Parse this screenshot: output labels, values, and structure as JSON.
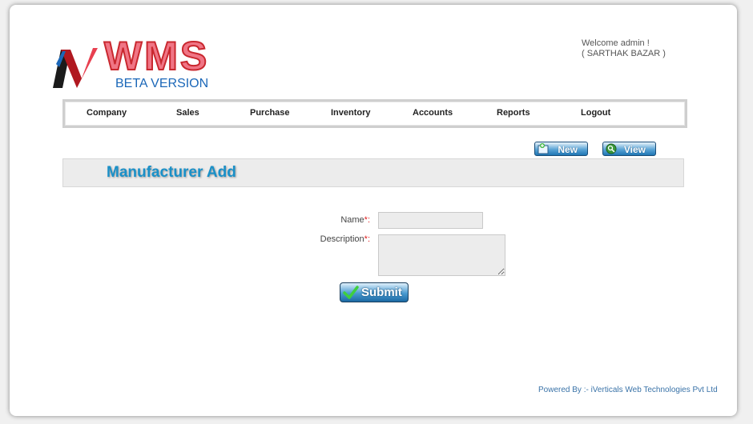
{
  "logo": {
    "text": "WMS",
    "subtitle": "BETA VERSION"
  },
  "header": {
    "welcome_line1": "Welcome admin !",
    "welcome_line2": "( SARTHAK BAZAR )"
  },
  "nav": {
    "items": [
      "Company",
      "Sales",
      "Purchase",
      "Inventory",
      "Accounts",
      "Reports",
      "Logout"
    ]
  },
  "toolbar": {
    "new_label": "New",
    "view_label": "View"
  },
  "page": {
    "title": "Manufacturer Add"
  },
  "form": {
    "name_label": "Name",
    "description_label": "Description",
    "required_mark": "*",
    "label_suffix": ":",
    "name_value": "",
    "description_value": "",
    "submit_label": "Submit"
  },
  "footer": {
    "text": "Powered By :- iVerticals Web Technologies Pvt Ltd"
  },
  "colors": {
    "accent": "#1a90c8",
    "required": "#e02020",
    "logo_red": "#c9282f",
    "logo_blue": "#1b67b8"
  },
  "icons": {
    "new": "new-document-icon",
    "view": "magnifier-icon",
    "submit": "checkmark-icon"
  }
}
